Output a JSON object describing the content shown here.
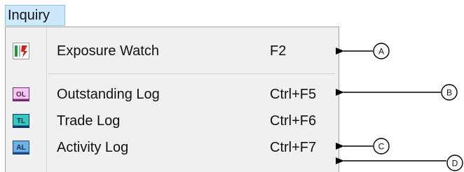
{
  "menubar": {
    "title": "Inquiry"
  },
  "menu": {
    "items": [
      {
        "label": "Exposure Watch",
        "shortcut": "F2",
        "icon": "exposure-watch-icon"
      },
      {
        "label": "Outstanding Log",
        "shortcut": "Ctrl+F5",
        "icon": "outstanding-log-icon",
        "icon_text": "OL"
      },
      {
        "label": "Trade Log",
        "shortcut": "Ctrl+F6",
        "icon": "trade-log-icon",
        "icon_text": "TL"
      },
      {
        "label": "Activity Log",
        "shortcut": "Ctrl+F7",
        "icon": "activity-log-icon",
        "icon_text": "AL"
      }
    ]
  },
  "callouts": {
    "a": "A",
    "b": "B",
    "c": "C",
    "d": "D"
  },
  "colors": {
    "menubar_highlight": "#cde8fb",
    "menu_background": "#f0f0f0",
    "exposure_green": "#1a9a3a",
    "exposure_red": "#d62020",
    "ol_pink": "#f3c8ef",
    "tl_teal": "#38c6c0",
    "al_blue": "#6fb0e0"
  }
}
